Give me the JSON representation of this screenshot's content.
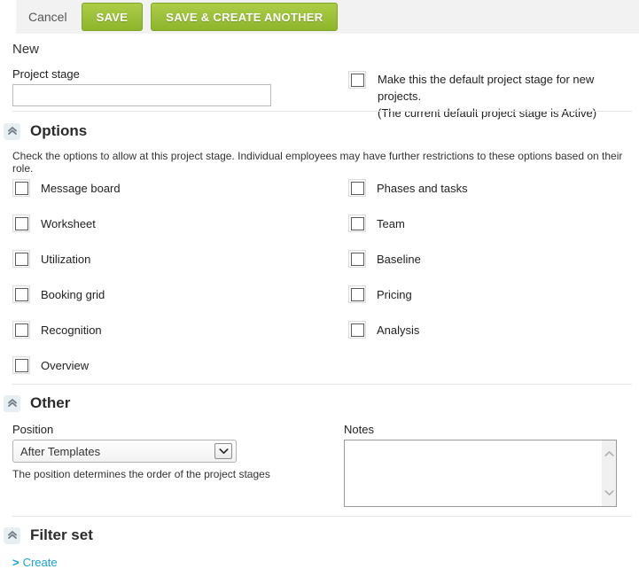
{
  "toolbar": {
    "cancel_label": "Cancel",
    "save_label": "SAVE",
    "save_create_label": "SAVE & CREATE ANOTHER",
    "accent_green": "#9cc03a",
    "background": "#f2f2f2"
  },
  "page": {
    "title": "New"
  },
  "project_stage": {
    "label": "Project stage",
    "value": "",
    "placeholder": ""
  },
  "default_stage": {
    "checkbox_checked": false,
    "line1": "Make this the default project stage for new projects.",
    "line2": "(The current default project stage is Active)"
  },
  "options_section": {
    "collapse_icon": "chevron-double-up-icon",
    "title": "Options",
    "helper": "Check the options to allow at this project stage. Individual employees may have further restrictions to these options based on their role.",
    "left_column": [
      {
        "label": "Message board",
        "checked": false
      },
      {
        "label": "Worksheet",
        "checked": false
      },
      {
        "label": "Utilization",
        "checked": false
      },
      {
        "label": "Booking grid",
        "checked": false
      },
      {
        "label": "Recognition",
        "checked": false
      },
      {
        "label": "Overview",
        "checked": false
      }
    ],
    "right_column": [
      {
        "label": "Phases and tasks",
        "checked": false
      },
      {
        "label": "Team",
        "checked": false
      },
      {
        "label": "Baseline",
        "checked": false
      },
      {
        "label": "Pricing",
        "checked": false
      },
      {
        "label": "Analysis",
        "checked": false
      }
    ]
  },
  "other_section": {
    "collapse_icon": "chevron-double-up-icon",
    "title": "Other",
    "position": {
      "label": "Position",
      "selected": "After Templates",
      "helper": "The position determines the order of the project stages"
    },
    "notes": {
      "label": "Notes",
      "value": "",
      "scroll_up_icon": "chevron-up-icon",
      "scroll_down_icon": "chevron-down-icon"
    }
  },
  "filter_set_section": {
    "collapse_icon": "chevron-double-up-icon",
    "title": "Filter set",
    "create_chevron": ">",
    "create_label": "Create",
    "link_color": "#19a0d6"
  }
}
